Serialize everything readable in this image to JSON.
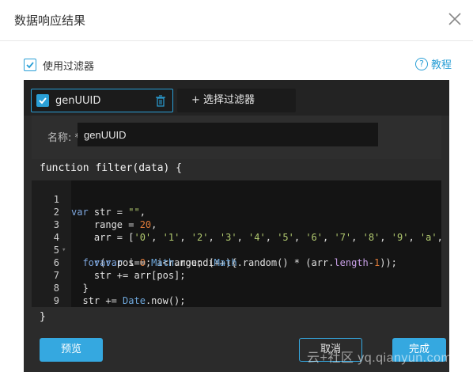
{
  "dialog": {
    "title": "数据响应结果"
  },
  "use_filter": {
    "label": "使用过滤器",
    "checked": true
  },
  "help": {
    "icon": "question-circle-icon",
    "label": "教程"
  },
  "tabs": {
    "filter_name": "genUUID",
    "add_label": "+ 选择过滤器"
  },
  "name_field": {
    "label": "名称: *",
    "value": "genUUID"
  },
  "code": {
    "header": "function filter(data) {",
    "footer": "}",
    "line_numbers": [
      "1",
      "2",
      "3",
      "4",
      "5",
      "6",
      "7",
      "8",
      "9",
      "10"
    ]
  },
  "buttons": {
    "preview": "预览",
    "cancel": "取消",
    "done": "完成"
  },
  "watermark": "云+社区 yq.qianyun.com",
  "colors": {
    "accent": "#2a9fd6",
    "button": "#35a8e0",
    "panel": "#2b2b2b"
  }
}
